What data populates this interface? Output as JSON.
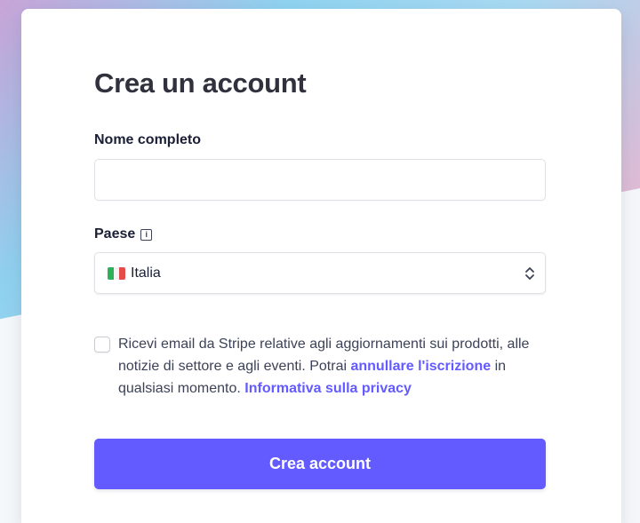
{
  "form": {
    "title": "Crea un account",
    "name_label": "Nome completo",
    "name_value": "",
    "name_placeholder": "",
    "country_label": "Paese",
    "country_info_icon": "info-icon",
    "country_selected": "Italia",
    "country_flag": "italy-flag-icon",
    "consent_text_1": "Ricevi email da Stripe relative agli aggiornamenti sui prodotti, alle notizie di settore e agli eventi. Potrai ",
    "consent_link_unsubscribe": "annullare l'iscrizione",
    "consent_text_2": " in qualsiasi momento. ",
    "consent_link_privacy": "Informativa sulla privacy",
    "consent_checked": false,
    "submit_label": "Crea account"
  },
  "colors": {
    "accent": "#635bff",
    "title": "#30313d",
    "text": "#3c4257"
  }
}
